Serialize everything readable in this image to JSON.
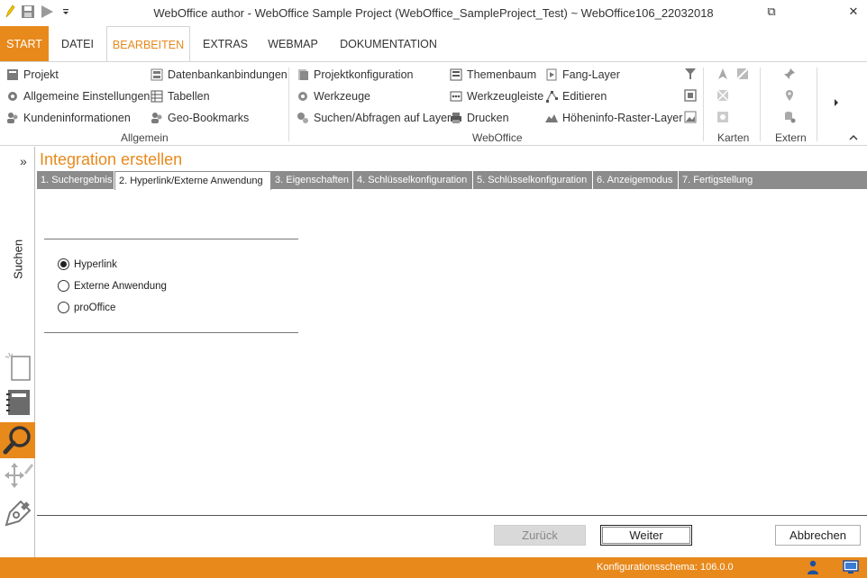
{
  "window": {
    "title": "WebOffice author - WebOffice Sample Project (WebOffice_SampleProject_Test) ~ WebOffice106_22032018",
    "pin_glyph": "⧉",
    "close_glyph": "✕"
  },
  "ribbon_tabs": [
    {
      "label": "START"
    },
    {
      "label": "DATEI"
    },
    {
      "label": "BEARBEITEN"
    },
    {
      "label": "EXTRAS"
    },
    {
      "label": "WEBMAP"
    },
    {
      "label": "DOKUMENTATION"
    }
  ],
  "ribbon": {
    "allgemein": {
      "label": "Allgemein",
      "items": [
        "Projekt",
        "Allgemeine Einstellungen",
        "Kundeninformationen",
        "Datenbankanbindungen",
        "Tabellen",
        "Geo-Bookmarks"
      ]
    },
    "weboffice": {
      "label": "WebOffice",
      "items": [
        "Projektkonfiguration",
        "Werkzeuge",
        "Suchen/Abfragen auf Layer",
        "Themenbaum",
        "Werkzeugleiste",
        "Drucken",
        "Fang-Layer",
        "Editieren",
        "Höheninfo-Raster-Layer"
      ]
    },
    "karten": {
      "label": "Karten"
    },
    "extern": {
      "label": "Extern"
    }
  },
  "sidepanel": {
    "expand_glyph": "»",
    "label": "Suchen"
  },
  "wizard": {
    "title": "Integration erstellen",
    "steps": [
      "1. Suchergebnis",
      "2. Hyperlink/Externe Anwendung",
      "3. Eigenschaften",
      "4. Schlüsselkonfiguration",
      "5. Schlüsselkonfiguration",
      "6. Anzeigemodus",
      "7. Fertigstellung"
    ],
    "options": [
      "Hyperlink",
      "Externe Anwendung",
      "proOffice"
    ],
    "buttons": {
      "back": "Zurück",
      "next": "Weiter",
      "cancel": "Abbrechen"
    }
  },
  "status": {
    "text": "Konfigurationsschema:  106.0.0"
  },
  "colors": {
    "accent": "#e8891c",
    "step_bar": "#8c8c8c"
  }
}
